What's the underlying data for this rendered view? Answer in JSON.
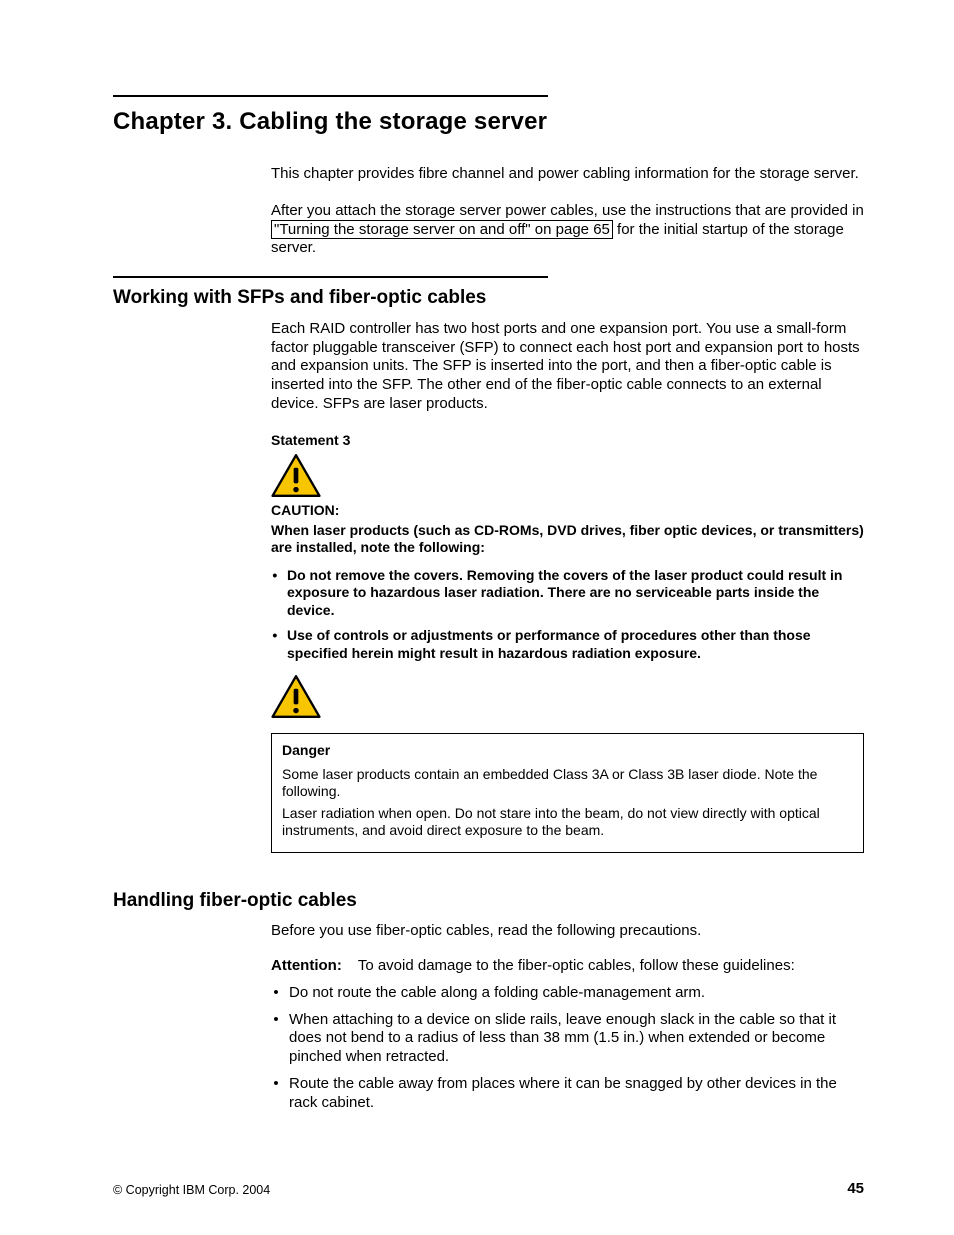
{
  "chapter": {
    "title": "Chapter 3. Cabling the storage server",
    "intro1": "This chapter provides fibre channel and power cabling information for the storage server.",
    "intro2_pre": "After you attach the storage server power cables, use the instructions that are provided in ",
    "intro2_link": "\"Turning the storage server on and off\" on page 65",
    "intro2_post": " for the initial startup of the storage server."
  },
  "section1": {
    "title": "Working with SFPs and fiber-optic cables",
    "para": "Each RAID controller has two host ports and one expansion port. You use a small-form factor pluggable transceiver (SFP) to connect each host port and expansion port to hosts and expansion units. The SFP is inserted into the port, and then a fiber-optic cable is inserted into the SFP. The other end of the fiber-optic cable connects to an external device. SFPs are laser products.",
    "statement": "Statement 3",
    "caution_label": "CAUTION:",
    "caution_text": "When laser products (such as CD-ROMs, DVD drives, fiber optic devices, or transmitters) are installed, note the following:",
    "bullets": [
      "Do not remove the covers. Removing the covers of the laser product could result in exposure to hazardous laser radiation. There are no serviceable parts inside the device.",
      "Use of controls or adjustments or performance of procedures other than those specified herein might result in hazardous radiation exposure."
    ],
    "danger_title": "Danger",
    "danger_body1": "Some laser products contain an embedded Class 3A or Class 3B laser diode. Note the following.",
    "danger_body2": "Laser radiation when open. Do not stare into the beam, do not view directly with optical instruments, and avoid direct exposure to the beam."
  },
  "section2": {
    "title": "Handling fiber-optic cables",
    "para": "Before you use fiber-optic cables, read the following precautions.",
    "attn_label": "Attention:",
    "attn_text": "To avoid damage to the fiber-optic cables, follow these guidelines:",
    "bullets": [
      "Do not route the cable along a folding cable-management arm.",
      "When attaching to a device on slide rails, leave enough slack in the cable so that it does not bend to a radius of less than 38 mm (1.5 in.) when extended or become pinched when retracted.",
      "Route the cable away from places where it can be snagged by other devices in the rack cabinet."
    ]
  },
  "footer": {
    "copyright": "© Copyright IBM Corp. 2004",
    "page": "45"
  },
  "icon_colors": {
    "fill": "#F7C600",
    "stroke": "#000000"
  }
}
